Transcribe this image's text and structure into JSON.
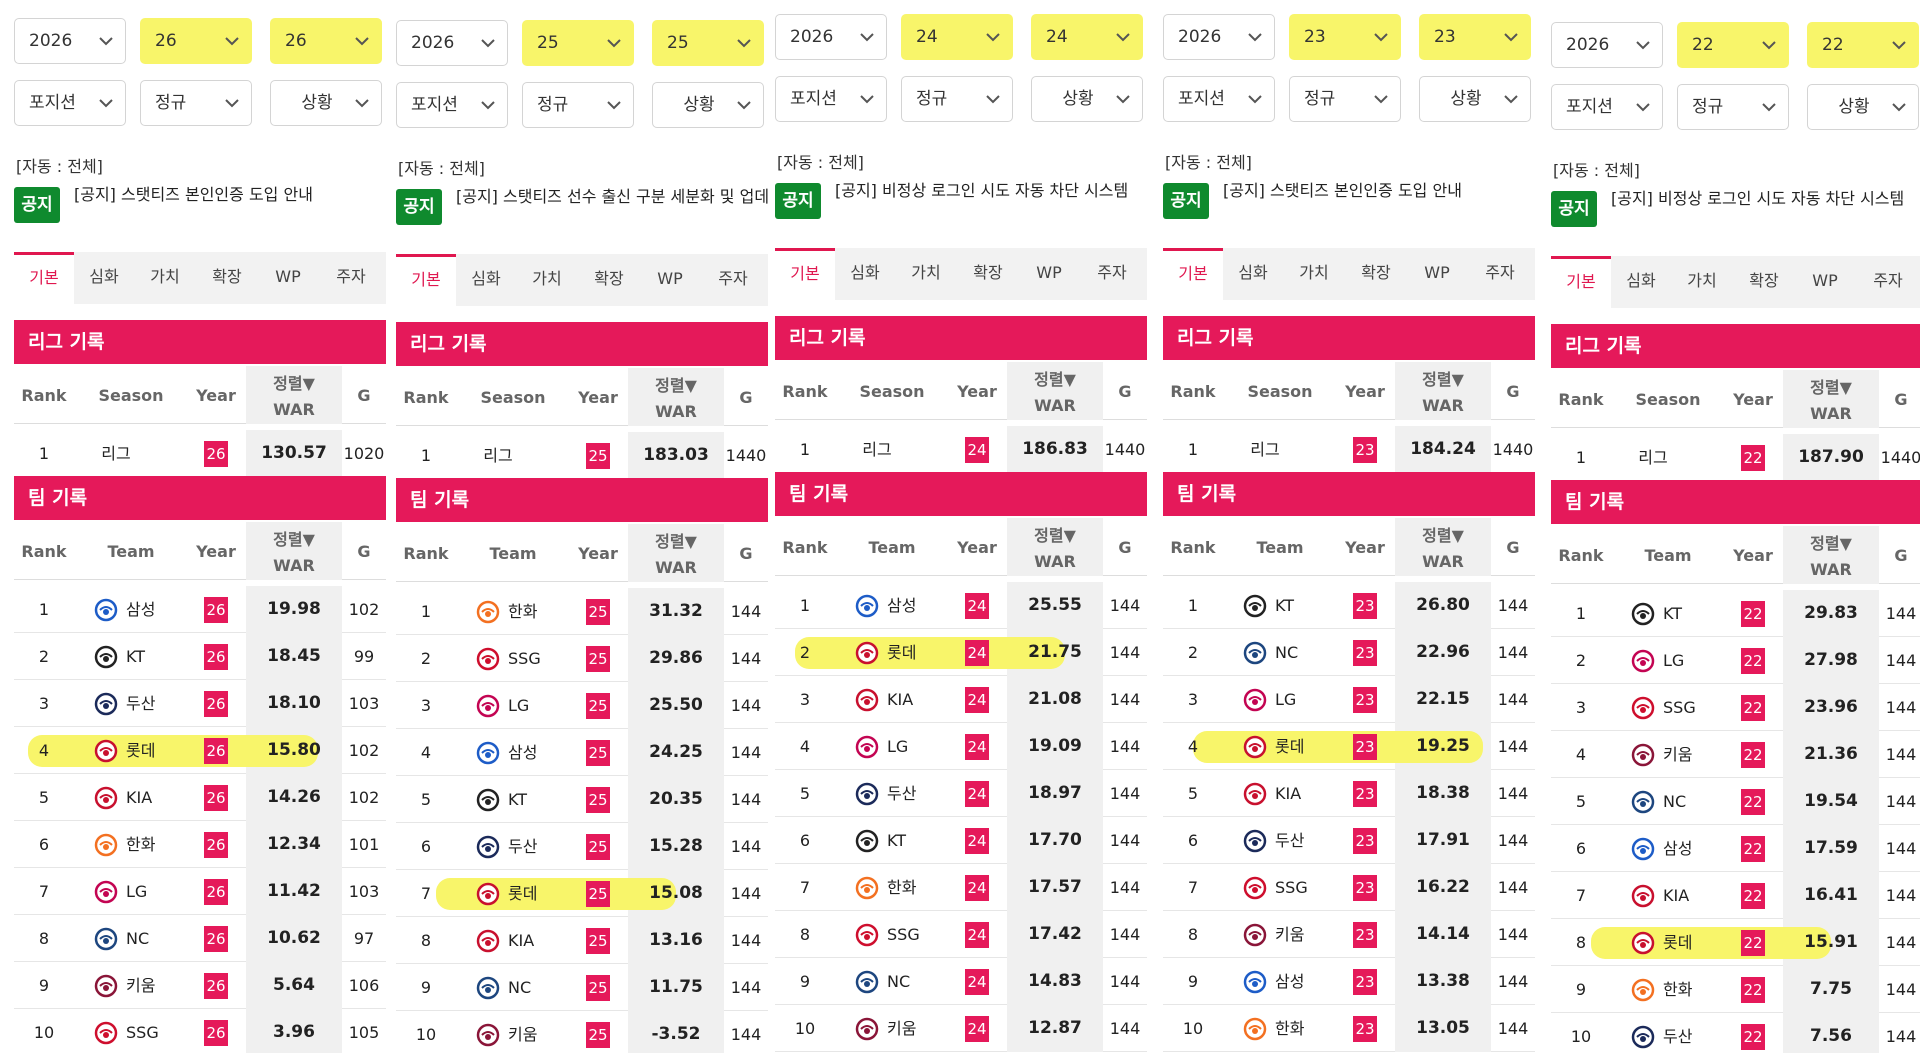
{
  "colors": {
    "accent": "#e5195a",
    "notice": "#0f8a2e",
    "highlight": "#f8f56a"
  },
  "filter_labels": {
    "position": "포지션",
    "regular": "정규",
    "situation": "상황"
  },
  "auto_label": "[자동 : 전체]",
  "notice_badge": "공지",
  "tabs": [
    "기본",
    "심화",
    "가치",
    "확장",
    "WP",
    "주자"
  ],
  "league_title": "리그 기록",
  "team_title": "팀 기록",
  "league_headers": {
    "rank": "Rank",
    "season": "Season",
    "year": "Year",
    "sort": "정렬▼",
    "war": "WAR",
    "g": "G"
  },
  "team_headers": {
    "rank": "Rank",
    "team": "Team",
    "year": "Year",
    "sort": "정렬▼",
    "war": "WAR",
    "g": "G"
  },
  "panels": [
    {
      "year_select": "2026",
      "from": "26",
      "to": "26",
      "notice_text": "[공지] 스탯티즈 본인인증 도입 안내",
      "league": {
        "rank": "1",
        "season": "리그",
        "year": "26",
        "war": "130.57",
        "g": "1020"
      },
      "teams": [
        {
          "rank": "1",
          "team": "삼성",
          "logo": "lions-logo",
          "year": "26",
          "war": "19.98",
          "g": "102"
        },
        {
          "rank": "2",
          "team": "KT",
          "logo": "wiz-logo",
          "year": "26",
          "war": "18.45",
          "g": "99"
        },
        {
          "rank": "3",
          "team": "두산",
          "logo": "bears-logo",
          "year": "26",
          "war": "18.10",
          "g": "103"
        },
        {
          "rank": "4",
          "team": "롯데",
          "logo": "giants-logo",
          "year": "26",
          "war": "15.80",
          "g": "102",
          "highlight": true
        },
        {
          "rank": "5",
          "team": "KIA",
          "logo": "tigers-logo",
          "year": "26",
          "war": "14.26",
          "g": "102"
        },
        {
          "rank": "6",
          "team": "한화",
          "logo": "eagles-logo",
          "year": "26",
          "war": "12.34",
          "g": "101"
        },
        {
          "rank": "7",
          "team": "LG",
          "logo": "twins-logo",
          "year": "26",
          "war": "11.42",
          "g": "103"
        },
        {
          "rank": "8",
          "team": "NC",
          "logo": "dinos-logo",
          "year": "26",
          "war": "10.62",
          "g": "97"
        },
        {
          "rank": "9",
          "team": "키움",
          "logo": "heroes-logo",
          "year": "26",
          "war": "5.64",
          "g": "106"
        },
        {
          "rank": "10",
          "team": "SSG",
          "logo": "landers-logo",
          "year": "26",
          "war": "3.96",
          "g": "105"
        }
      ]
    },
    {
      "year_select": "2026",
      "from": "25",
      "to": "25",
      "notice_text": "[공지] 스탯티즈 선수 출신 구분 세분화 및 업데이트",
      "league": {
        "rank": "1",
        "season": "리그",
        "year": "25",
        "war": "183.03",
        "g": "1440"
      },
      "teams": [
        {
          "rank": "1",
          "team": "한화",
          "logo": "eagles-logo",
          "year": "25",
          "war": "31.32",
          "g": "144"
        },
        {
          "rank": "2",
          "team": "SSG",
          "logo": "landers-logo",
          "year": "25",
          "war": "29.86",
          "g": "144"
        },
        {
          "rank": "3",
          "team": "LG",
          "logo": "twins-logo",
          "year": "25",
          "war": "25.50",
          "g": "144"
        },
        {
          "rank": "4",
          "team": "삼성",
          "logo": "lions-logo",
          "year": "25",
          "war": "24.25",
          "g": "144"
        },
        {
          "rank": "5",
          "team": "KT",
          "logo": "wiz-logo",
          "year": "25",
          "war": "20.35",
          "g": "144"
        },
        {
          "rank": "6",
          "team": "두산",
          "logo": "bears-logo",
          "year": "25",
          "war": "15.28",
          "g": "144"
        },
        {
          "rank": "7",
          "team": "롯데",
          "logo": "giants-logo",
          "year": "25",
          "war": "15.08",
          "g": "144",
          "highlight": true
        },
        {
          "rank": "8",
          "team": "KIA",
          "logo": "tigers-logo",
          "year": "25",
          "war": "13.16",
          "g": "144"
        },
        {
          "rank": "9",
          "team": "NC",
          "logo": "dinos-logo",
          "year": "25",
          "war": "11.75",
          "g": "144"
        },
        {
          "rank": "10",
          "team": "키움",
          "logo": "heroes-logo",
          "year": "25",
          "war": "-3.52",
          "g": "144"
        }
      ]
    },
    {
      "year_select": "2026",
      "from": "24",
      "to": "24",
      "notice_text": "[공지] 비정상 로그인 시도 자동 차단 시스템",
      "league": {
        "rank": "1",
        "season": "리그",
        "year": "24",
        "war": "186.83",
        "g": "1440"
      },
      "teams": [
        {
          "rank": "1",
          "team": "삼성",
          "logo": "lions-logo",
          "year": "24",
          "war": "25.55",
          "g": "144"
        },
        {
          "rank": "2",
          "team": "롯데",
          "logo": "giants-logo",
          "year": "24",
          "war": "21.75",
          "g": "144",
          "highlight": true
        },
        {
          "rank": "3",
          "team": "KIA",
          "logo": "tigers-logo",
          "year": "24",
          "war": "21.08",
          "g": "144"
        },
        {
          "rank": "4",
          "team": "LG",
          "logo": "twins-logo",
          "year": "24",
          "war": "19.09",
          "g": "144"
        },
        {
          "rank": "5",
          "team": "두산",
          "logo": "bears-logo",
          "year": "24",
          "war": "18.97",
          "g": "144"
        },
        {
          "rank": "6",
          "team": "KT",
          "logo": "wiz-logo",
          "year": "24",
          "war": "17.70",
          "g": "144"
        },
        {
          "rank": "7",
          "team": "한화",
          "logo": "eagles-logo",
          "year": "24",
          "war": "17.57",
          "g": "144"
        },
        {
          "rank": "8",
          "team": "SSG",
          "logo": "landers-logo",
          "year": "24",
          "war": "17.42",
          "g": "144"
        },
        {
          "rank": "9",
          "team": "NC",
          "logo": "dinos-logo",
          "year": "24",
          "war": "14.83",
          "g": "144"
        },
        {
          "rank": "10",
          "team": "키움",
          "logo": "heroes-logo",
          "year": "24",
          "war": "12.87",
          "g": "144"
        }
      ]
    },
    {
      "year_select": "2026",
      "from": "23",
      "to": "23",
      "notice_text": "[공지] 스탯티즈 본인인증 도입 안내",
      "league": {
        "rank": "1",
        "season": "리그",
        "year": "23",
        "war": "184.24",
        "g": "1440"
      },
      "teams": [
        {
          "rank": "1",
          "team": "KT",
          "logo": "wiz-logo",
          "year": "23",
          "war": "26.80",
          "g": "144"
        },
        {
          "rank": "2",
          "team": "NC",
          "logo": "dinos-logo",
          "year": "23",
          "war": "22.96",
          "g": "144"
        },
        {
          "rank": "3",
          "team": "LG",
          "logo": "twins-logo",
          "year": "23",
          "war": "22.15",
          "g": "144"
        },
        {
          "rank": "4",
          "team": "롯데",
          "logo": "giants-logo",
          "year": "23",
          "war": "19.25",
          "g": "144",
          "highlight": true
        },
        {
          "rank": "5",
          "team": "KIA",
          "logo": "tigers-logo",
          "year": "23",
          "war": "18.38",
          "g": "144"
        },
        {
          "rank": "6",
          "team": "두산",
          "logo": "bears-logo",
          "year": "23",
          "war": "17.91",
          "g": "144"
        },
        {
          "rank": "7",
          "team": "SSG",
          "logo": "landers-logo",
          "year": "23",
          "war": "16.22",
          "g": "144"
        },
        {
          "rank": "8",
          "team": "키움",
          "logo": "heroes-logo",
          "year": "23",
          "war": "14.14",
          "g": "144"
        },
        {
          "rank": "9",
          "team": "삼성",
          "logo": "lions-logo",
          "year": "23",
          "war": "13.38",
          "g": "144"
        },
        {
          "rank": "10",
          "team": "한화",
          "logo": "eagles-logo",
          "year": "23",
          "war": "13.05",
          "g": "144"
        }
      ]
    },
    {
      "year_select": "2026",
      "from": "22",
      "to": "22",
      "notice_text": "[공지] 비정상 로그인 시도 자동 차단 시스템",
      "league": {
        "rank": "1",
        "season": "리그",
        "year": "22",
        "war": "187.90",
        "g": "1440"
      },
      "teams": [
        {
          "rank": "1",
          "team": "KT",
          "logo": "wiz-logo",
          "year": "22",
          "war": "29.83",
          "g": "144"
        },
        {
          "rank": "2",
          "team": "LG",
          "logo": "twins-logo",
          "year": "22",
          "war": "27.98",
          "g": "144"
        },
        {
          "rank": "3",
          "team": "SSG",
          "logo": "landers-logo",
          "year": "22",
          "war": "23.96",
          "g": "144"
        },
        {
          "rank": "4",
          "team": "키움",
          "logo": "heroes-logo",
          "year": "22",
          "war": "21.36",
          "g": "144"
        },
        {
          "rank": "5",
          "team": "NC",
          "logo": "dinos-logo",
          "year": "22",
          "war": "19.54",
          "g": "144"
        },
        {
          "rank": "6",
          "team": "삼성",
          "logo": "lions-logo",
          "year": "22",
          "war": "17.59",
          "g": "144"
        },
        {
          "rank": "7",
          "team": "KIA",
          "logo": "tigers-logo",
          "year": "22",
          "war": "16.41",
          "g": "144"
        },
        {
          "rank": "8",
          "team": "롯데",
          "logo": "giants-logo",
          "year": "22",
          "war": "15.91",
          "g": "144",
          "highlight": true
        },
        {
          "rank": "9",
          "team": "한화",
          "logo": "eagles-logo",
          "year": "22",
          "war": "7.75",
          "g": "144"
        },
        {
          "rank": "10",
          "team": "두산",
          "logo": "bears-logo",
          "year": "22",
          "war": "7.56",
          "g": "144"
        }
      ]
    }
  ]
}
